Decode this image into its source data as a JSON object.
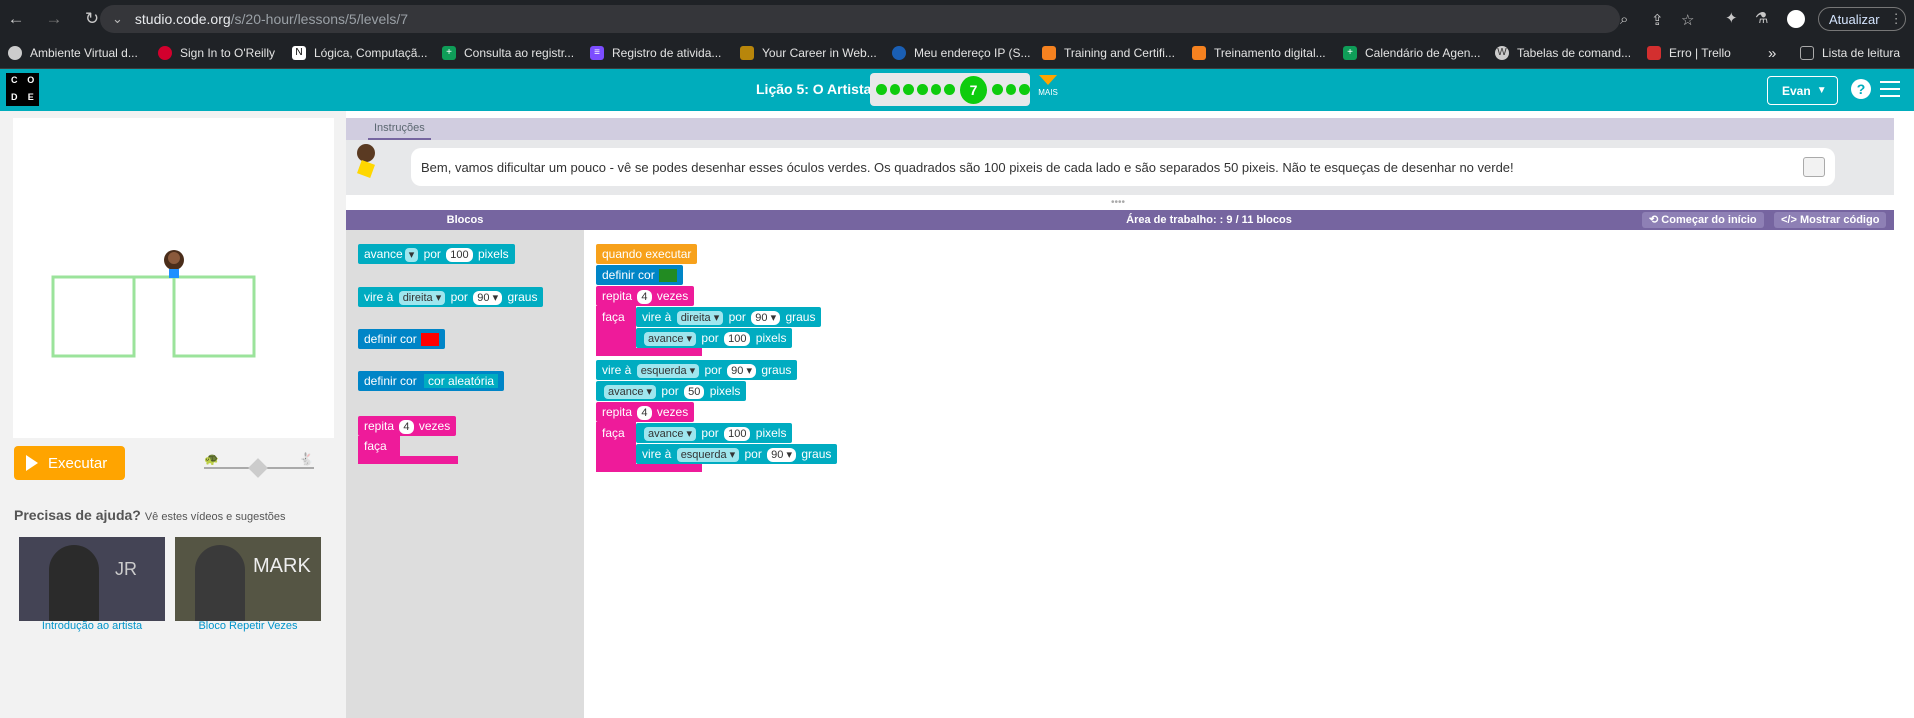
{
  "browser": {
    "url_host": "studio.code.org",
    "url_path": "/s/20-hour/lessons/5/levels/7",
    "update_label": "Atualizar",
    "bookmarks": [
      "Ambiente Virtual d...",
      "Sign In to O'Reilly",
      "Lógica, Computaçã...",
      "Consulta ao registr...",
      "Registro de ativida...",
      "Your Career in Web...",
      "Meu endereço IP (S...",
      "Training and Certifi...",
      "Treinamento digital...",
      "Calendário de Agen...",
      "Tabelas de comand...",
      "Erro | Trello"
    ],
    "more_bookmarks": "»",
    "reading_list": "Lista de leitura"
  },
  "header": {
    "logo_letters": [
      "C",
      "O",
      "D",
      "E"
    ],
    "lesson_title": "Lição 5: O Artista",
    "current_level": "7",
    "more_label": "MAIS",
    "user_name": "Evan",
    "help": "?"
  },
  "left": {
    "run_label": "Executar",
    "help_title": "Precisas de ajuda?",
    "help_subtitle": "Vê estes vídeos e sugestões",
    "videos": [
      {
        "label": "Introdução ao artista",
        "overlay": "JR"
      },
      {
        "label": "Bloco Repetir Vezes",
        "overlay": "MARK"
      }
    ]
  },
  "instructions": {
    "tab": "Instruções",
    "text": "Bem, vamos dificultar um pouco - vê se podes desenhar esses óculos verdes. Os quadrados são 100 pixeis de cada lado e são separados 50 pixeis. Não te esqueças de desenhar no verde!"
  },
  "workspace_header": {
    "blocks": "Blocos",
    "title": "Área de trabalho: : 9 / 11 blocos",
    "restart": "Começar do início",
    "show_code": "Mostrar código"
  },
  "blocks": {
    "avance": "avance",
    "por": "por",
    "pixels": "pixels",
    "vire": "vire à",
    "direita": "direita",
    "esquerda": "esquerda",
    "graus": "graus",
    "definir_cor": "definir cor",
    "cor_aleatoria": "cor aleatória",
    "repita": "repita",
    "vezes": "vezes",
    "faca": "faça",
    "quando": "quando executar",
    "n100": "100",
    "n90": "90",
    "n4": "4",
    "n50": "50",
    "red": "#ff0000",
    "green": "#228b22"
  }
}
